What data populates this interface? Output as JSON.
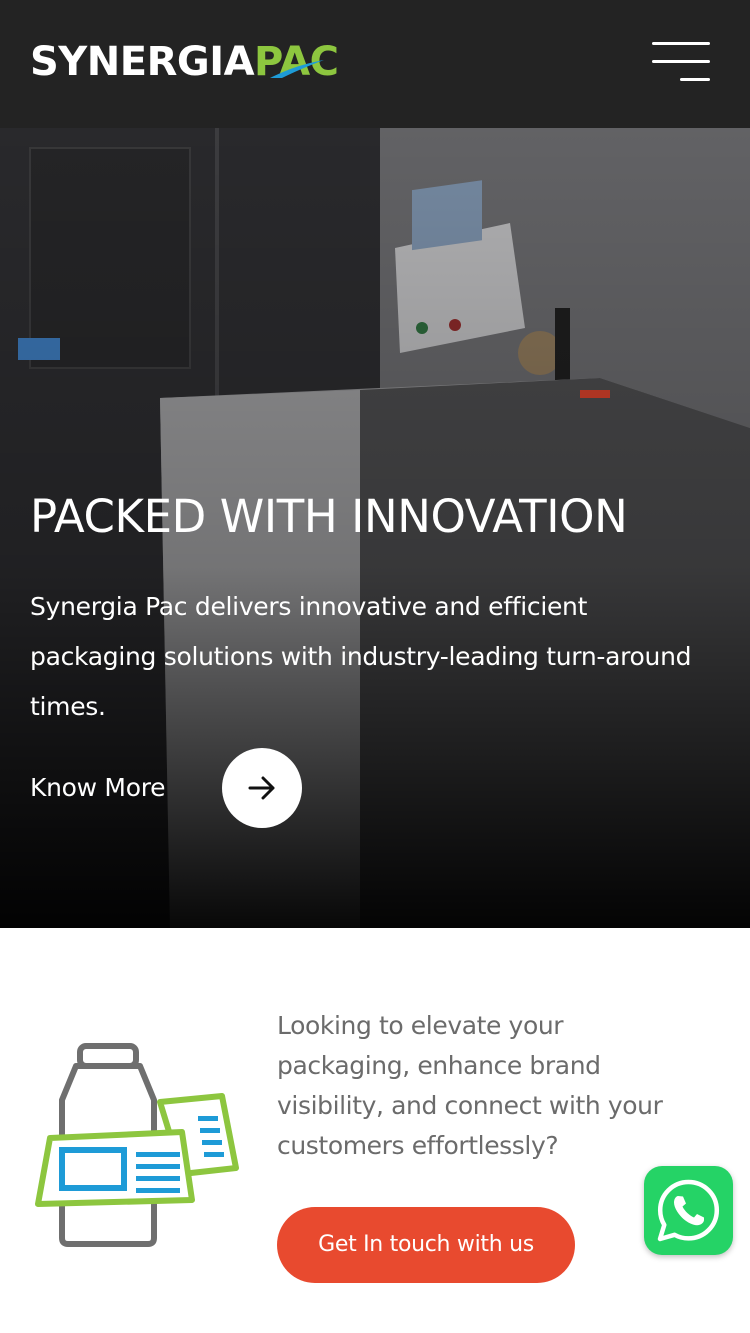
{
  "header": {
    "brand_part1": "SYNERGIA",
    "brand_part2": "PAC",
    "menu_icon": "hamburger-menu-icon"
  },
  "hero": {
    "title": "PACKED WITH INNOVATION",
    "description": "Synergia Pac delivers innovative and efficient packaging solutions with industry-leading turn-around times.",
    "cta_label": "Know More",
    "cta_icon": "arrow-right-icon"
  },
  "cta_section": {
    "icon": "bottle-label-icon",
    "text": "Looking to elevate your packaging, enhance brand visibility, and connect with your customers effortlessly?",
    "button_label": "Get In touch with us"
  },
  "floating": {
    "whatsapp_icon": "whatsapp-icon"
  },
  "colors": {
    "header_bg": "#232323",
    "brand_green": "#8dc63f",
    "brand_blue": "#1e9bd7",
    "cta_red": "#e84a2f",
    "whatsapp_green": "#25d366",
    "body_text": "#6b6b6b"
  }
}
